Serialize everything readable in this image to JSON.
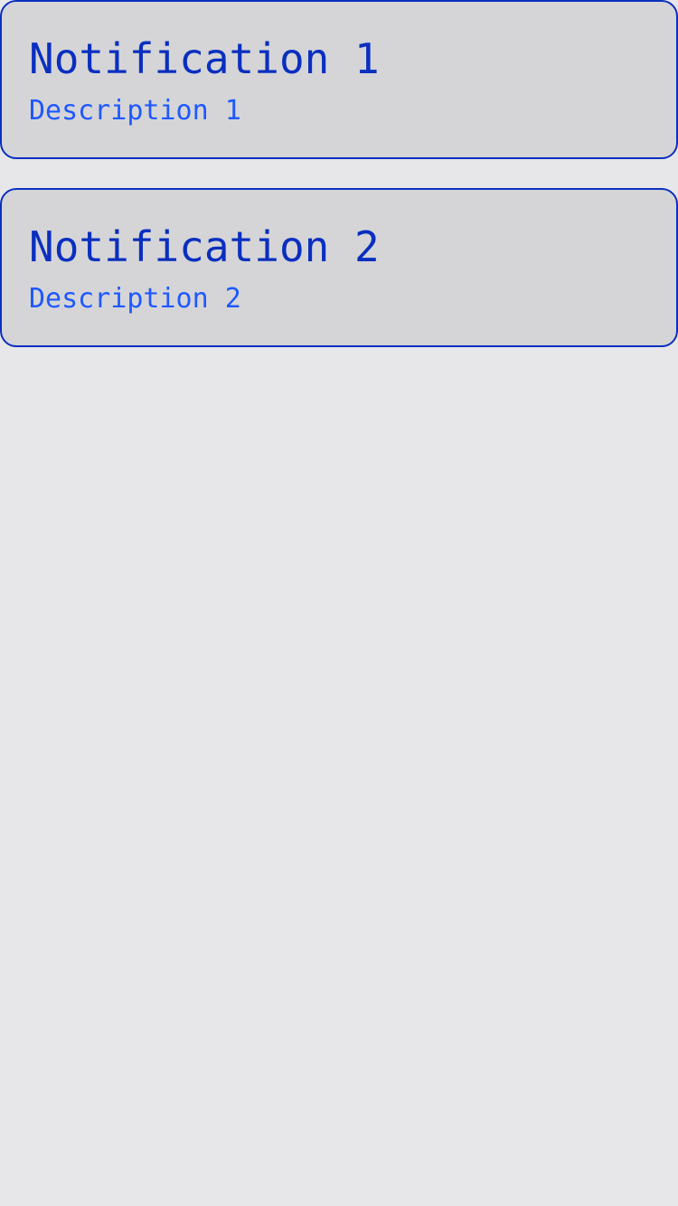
{
  "notifications": [
    {
      "title": "Notification 1",
      "description": "Description 1"
    },
    {
      "title": "Notification 2",
      "description": "Description 2"
    }
  ],
  "colors": {
    "background": "#e7e7e9",
    "card_background": "#d5d5d8",
    "card_border": "#0a2fbf",
    "title_text": "#0a2fbf",
    "description_text": "#1f58ff"
  }
}
